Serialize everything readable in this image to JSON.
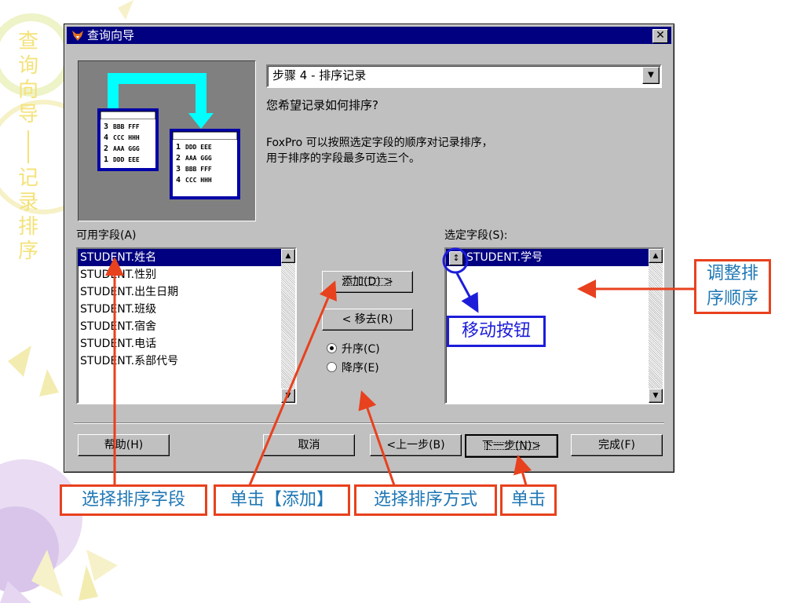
{
  "side_title": {
    "chars": [
      "查",
      "询",
      "向",
      "导",
      "记",
      "录",
      "排",
      "序"
    ]
  },
  "dialog": {
    "title": "查询向导",
    "close_label": "✕",
    "step_label": "步骤 4 - 排序记录",
    "question": "您希望记录如何排序?",
    "description_line1": "FoxPro 可以按照选定字段的顺序对记录排序，",
    "description_line2": "用于排序的字段最多可选三个。",
    "available_label": "可用字段(A)",
    "selected_label": "选定字段(S):",
    "available_fields": [
      "STUDENT.姓名",
      "STUDENT.性别",
      "STUDENT.出生日期",
      "STUDENT.班级",
      "STUDENT.宿舍",
      "STUDENT.电话",
      "STUDENT.系部代号"
    ],
    "selected_fields": [
      "STUDENT.学号"
    ],
    "add_button": "添加(D) >",
    "remove_button": "< 移去(R)",
    "ascending": "升序(C)",
    "descending": "降序(E)",
    "help_button": "帮助(H)",
    "cancel_button": "取消",
    "back_button": "<上一步(B)",
    "next_button": "下一步(N)>",
    "finish_button": "完成(F)"
  },
  "picture": {
    "left_rows": [
      [
        "3",
        "BBB FFF"
      ],
      [
        "4",
        "CCC HHH"
      ],
      [
        "2",
        "AAA GGG"
      ],
      [
        "1",
        "DDD EEE"
      ]
    ],
    "right_rows": [
      [
        "1",
        "DDD EEE"
      ],
      [
        "2",
        "AAA GGG"
      ],
      [
        "3",
        "BBB FFF"
      ],
      [
        "4",
        "CCC HHH"
      ]
    ]
  },
  "annotations": {
    "select_field": "选择排序字段",
    "click_add": "单击【添加】",
    "select_order": "选择排序方式",
    "click": "单击",
    "move_button": "移动按钮",
    "adjust_order_line1": "调整排",
    "adjust_order_line2": "序顺序"
  },
  "colors": {
    "accent": "#e8411e",
    "titlebar": "#000080",
    "annotation_text": "#1f77b4",
    "side_title": "#f4e27a"
  }
}
